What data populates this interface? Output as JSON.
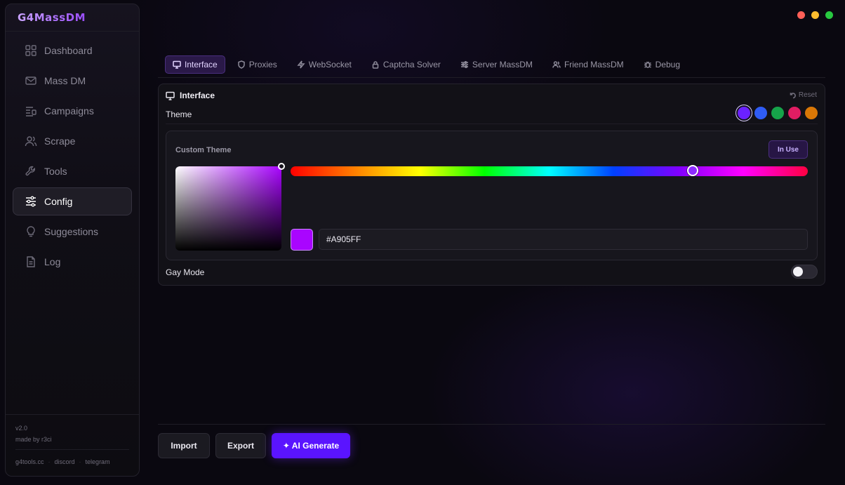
{
  "app": {
    "logo": "G4MassDM",
    "version": "v2.0",
    "made_by": "made by r3ci"
  },
  "window_controls": [
    {
      "name": "close",
      "color": "#ff5f57"
    },
    {
      "name": "minimize",
      "color": "#febc2e"
    },
    {
      "name": "maximize",
      "color": "#28c840"
    }
  ],
  "sidebar": {
    "items": [
      {
        "label": "Dashboard",
        "icon": "grid-icon"
      },
      {
        "label": "Mass DM",
        "icon": "mail-icon"
      },
      {
        "label": "Campaigns",
        "icon": "list-icon"
      },
      {
        "label": "Scrape",
        "icon": "users-icon"
      },
      {
        "label": "Tools",
        "icon": "wrench-icon"
      },
      {
        "label": "Config",
        "icon": "sliders-icon",
        "active": true
      },
      {
        "label": "Suggestions",
        "icon": "bulb-icon"
      },
      {
        "label": "Log",
        "icon": "file-icon"
      }
    ],
    "links": [
      "g4tools.cc",
      "discord",
      "telegram"
    ]
  },
  "tabs": [
    {
      "label": "Interface",
      "icon": "monitor-icon",
      "active": true
    },
    {
      "label": "Proxies",
      "icon": "shield-icon"
    },
    {
      "label": "WebSocket",
      "icon": "bolt-icon"
    },
    {
      "label": "Captcha Solver",
      "icon": "lock-icon"
    },
    {
      "label": "Server MassDM",
      "icon": "sliders-icon"
    },
    {
      "label": "Friend MassDM",
      "icon": "users-icon"
    },
    {
      "label": "Debug",
      "icon": "bug-icon"
    }
  ],
  "panel": {
    "title": "Interface",
    "reset_label": "Reset",
    "theme_label": "Theme",
    "theme_swatches": [
      "#6b21ff",
      "#2f5cf5",
      "#16a34a",
      "#e11d63",
      "#d97706"
    ],
    "selected_swatch": 0,
    "custom_theme": {
      "title": "Custom Theme",
      "in_use_label": "In Use",
      "hex_value": "#A905FF",
      "hue_fraction": 0.777
    },
    "gay_mode_label": "Gay Mode",
    "gay_mode_on": false
  },
  "actions": {
    "import_label": "Import",
    "export_label": "Export",
    "ai_generate_label": "✦ AI Generate"
  }
}
